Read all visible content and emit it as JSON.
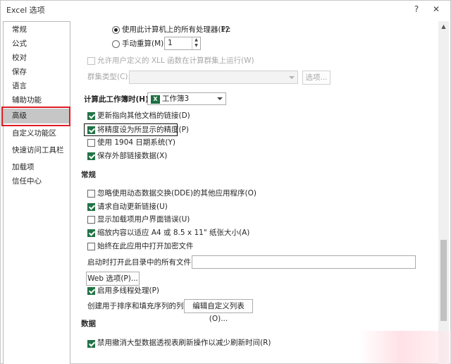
{
  "window": {
    "title": "Excel 选项",
    "help_label": "?",
    "close_label": "✕"
  },
  "sidebar": {
    "items": [
      {
        "label": "常规"
      },
      {
        "label": "公式"
      },
      {
        "label": "校对"
      },
      {
        "label": "保存"
      },
      {
        "label": "语言"
      },
      {
        "label": "辅助功能"
      },
      {
        "label": "高级"
      },
      {
        "label": "自定义功能区"
      },
      {
        "label": "快速访问工具栏"
      },
      {
        "label": "加载项"
      },
      {
        "label": "信任中心"
      }
    ],
    "selected": "高级",
    "highlight_color": "#e01c24"
  },
  "formulas": {
    "use_all_processors_label": "使用此计算机上的所有处理器(P):",
    "processor_count": "12",
    "manual_label": "手动重算(M)",
    "manual_value": "1",
    "xll_label": "允许用户定义的 XLL 函数在计算群集上运行(W)",
    "cluster_type_label": "群集类型(C):",
    "options_button": "选项..."
  },
  "workbook_calc": {
    "heading": "计算此工作簿时(H):",
    "workbook_name": "工作簿3",
    "update_links": "更新指向其他文档的链接(D)",
    "set_precision": "将精度设为所显示的精度(P)",
    "date_system": "使用 1904 日期系统(Y)",
    "save_external": "保存外部链接数据(X)"
  },
  "general": {
    "heading": "常规",
    "ignore_dde": "忽略使用动态数据交换(DDE)的其他应用程序(O)",
    "ask_update_links": "请求自动更新链接(U)",
    "show_addin_errors": "显示加载项用户界面错误(U)",
    "scale_content": "缩放内容以适应 A4 或 8.5 x 11\" 纸张大小(A)",
    "always_open_encrypted": "始终在此应用中打开加密文件",
    "startup_open_label": "启动时打开此目录中的所有文件(L):",
    "startup_open_value": "",
    "web_options_button": "Web 选项(P)...",
    "multithread": "启用多线程处理(P)",
    "custom_lists_label": "创建用于排序和填充序列的列表:",
    "edit_custom_lists_button": "编辑自定义列表(O)..."
  },
  "data": {
    "heading": "数据",
    "partial_item": "禁用撤消大型数据透视表刷新操作以减少刷新时间(R)"
  },
  "colors": {
    "accent_green": "#217346",
    "excel_icon": "#1d6f42"
  },
  "icons": [
    "excel-workbook-icon",
    "help-icon",
    "close-icon",
    "scroll-up-icon"
  ]
}
